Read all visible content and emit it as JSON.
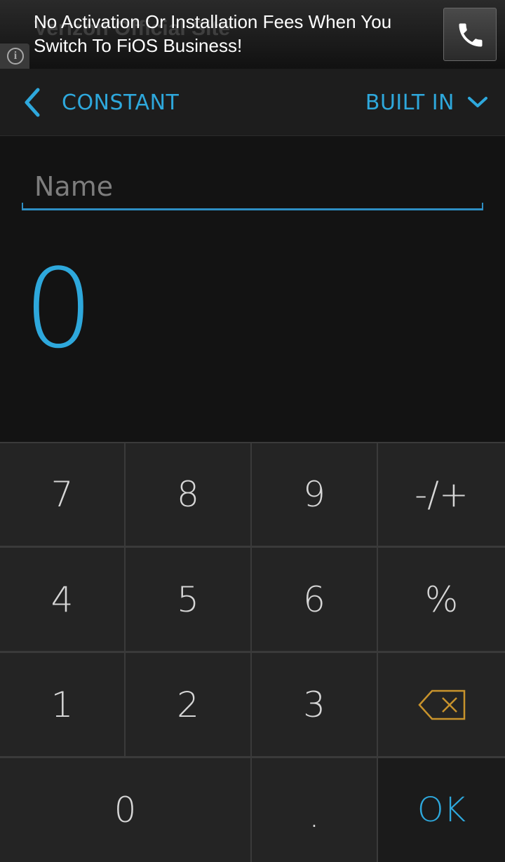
{
  "ad": {
    "background_text": "Verizon Official Site",
    "headline": "No Activation Or Installation Fees When You Switch To FiOS Business!",
    "info_icon": "info-icon",
    "call_icon": "phone-icon"
  },
  "actionbar": {
    "back_label": "CONSTANT",
    "back_icon": "chevron-left-icon",
    "dropdown_label": "BUILT IN",
    "dropdown_icon": "chevron-down-icon"
  },
  "name_input": {
    "placeholder": "Name",
    "value": ""
  },
  "display": {
    "value": "0"
  },
  "keypad": {
    "row1": [
      "7",
      "8",
      "9",
      "-/+"
    ],
    "row2": [
      "4",
      "5",
      "6",
      "%"
    ],
    "row3": [
      "1",
      "2",
      "3"
    ],
    "backspace_icon": "backspace-icon",
    "row4": [
      "0",
      ".",
      "OK"
    ]
  },
  "colors": {
    "accent": "#2ea8dc",
    "backspace": "#c8932c",
    "key_background": "#242424",
    "background": "#131313"
  }
}
